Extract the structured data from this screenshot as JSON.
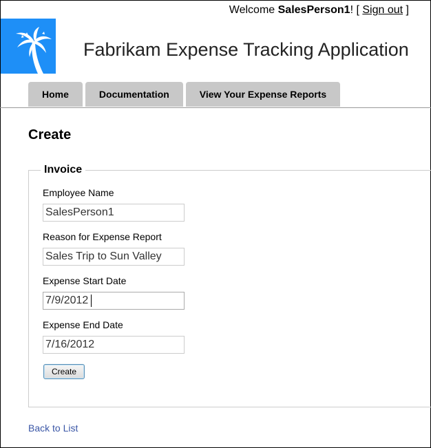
{
  "header": {
    "welcome_prefix": "Welcome",
    "username": "SalesPerson1",
    "welcome_after_user": "! [",
    "sign_out": "Sign out",
    "welcome_close": "]",
    "app_title": "Fabrikam Expense Tracking Application",
    "logo_icon": "palm-tree-icon",
    "logo_bg_color": "#1e8ff7"
  },
  "nav": {
    "tabs": [
      "Home",
      "Documentation",
      "View Your Expense Reports"
    ]
  },
  "page": {
    "title": "Create"
  },
  "form": {
    "legend": "Invoice",
    "fields": [
      {
        "label": "Employee Name",
        "value": "SalesPerson1"
      },
      {
        "label": "Reason for Expense Report",
        "value": "Sales Trip to Sun Valley"
      },
      {
        "label": "Expense Start Date",
        "value": "7/9/2012"
      },
      {
        "label": "Expense End Date",
        "value": "7/16/2012"
      }
    ],
    "submit_label": "Create"
  },
  "footer": {
    "back_link": "Back to List",
    "link_color": "#3a56a6"
  }
}
